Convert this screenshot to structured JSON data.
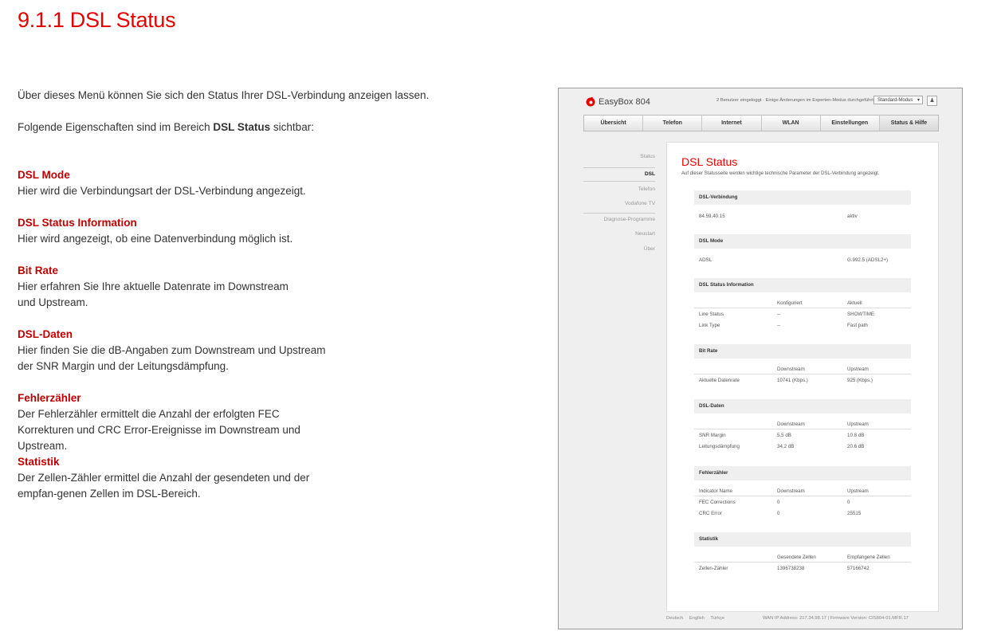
{
  "doc": {
    "title": "9.1.1 DSL Status",
    "intro1": "Über dieses Menü können Sie sich den Status Ihrer DSL-Verbindung anzeigen lassen.",
    "intro2_pre": "Folgende Eigenschaften sind im Bereich ",
    "intro2_bold": "DSL Status",
    "intro2_post": " sichtbar:",
    "properties": [
      {
        "heading": "DSL Mode",
        "text": "Hier wird die Verbindungsart der DSL-Verbindung angezeigt."
      },
      {
        "heading": "DSL Status Information",
        "text": "Hier wird angezeigt, ob eine Datenverbindung möglich ist."
      },
      {
        "heading": "Bit Rate",
        "text": "Hier erfahren Sie Ihre aktuelle Datenrate im Downstream und Upstream."
      },
      {
        "heading": "DSL-Daten",
        "text": "Hier finden Sie die dB-Angaben zum Downstream und Upstream der SNR Margin und der Leitungsdämpfung."
      },
      {
        "heading": "Fehlerzähler",
        "text": "Der Fehlerzähler ermittelt die Anzahl der erfolgten FEC Korrekturen und CRC Error-Ereignisse im Downstream und Upstream."
      },
      {
        "heading": "Statistik",
        "text": "Der Zellen-Zähler ermittel die Anzahl der gesendeten und der empfan-genen Zellen im DSL-Bereich."
      }
    ]
  },
  "screenshot": {
    "brand": "EasyBox 804",
    "brand_color": "#e60000",
    "logo_icon": "vodafone-logo-icon",
    "user_msg": "2 Benutzer eingeloggt · Einige Änderungen im Experten-Modus durchgeführt",
    "mode": "Standard-Modus",
    "nav": [
      "Übersicht",
      "Telefon",
      "Internet",
      "WLAN",
      "Einstellungen",
      "Status & Hilfe"
    ],
    "sidebar": [
      "Status",
      "DSL",
      "Telefon",
      "Vodafone TV",
      "Diagnose-Programme",
      "Neustart",
      "Über"
    ],
    "content_title": "DSL Status",
    "content_desc": "Auf dieser Statusseite werden wichtige technische Parameter der DSL-Verbindung angezeigt.",
    "sections": {
      "verbindung": {
        "title": "DSL-Verbindung",
        "ip": "84.59.40.15",
        "state": "aktiv"
      },
      "mode": {
        "title": "DSL Mode",
        "label": "ADSL",
        "value": "G.992.5 (ADSL2+)"
      },
      "info": {
        "title": "DSL Status Information",
        "h1": "Konfiguriert",
        "h2": "Aktuell",
        "rows": [
          [
            "Line Status",
            "--",
            "SHOWTIME"
          ],
          [
            "Link Type",
            "--",
            "Fast path"
          ]
        ]
      },
      "bitrate": {
        "title": "Bit Rate",
        "h1": "Downstream",
        "h2": "Upstream",
        "rows": [
          [
            "Aktuelle Datenrate",
            "10741 (Kbps.)",
            "925 (Kbps.)"
          ]
        ]
      },
      "daten": {
        "title": "DSL-Daten",
        "h1": "Downstream",
        "h2": "Upstream",
        "rows": [
          [
            "SNR Margin",
            "5.5 dB",
            "10.8 dB"
          ],
          [
            "Leitungsdämpfung",
            "34.2 dB",
            "20.6 dB"
          ]
        ]
      },
      "fehler": {
        "title": "Fehlerzähler",
        "h0": "Indicator Name",
        "h1": "Downstream",
        "h2": "Upstream",
        "rows": [
          [
            "FEC Corrections",
            "0",
            "0"
          ],
          [
            "CRC Error",
            "0",
            "25515"
          ]
        ]
      },
      "statistik": {
        "title": "Statistik",
        "h1": "Gesendete Zellen",
        "h2": "Empfangene Zellen",
        "rows": [
          [
            "Zellen-Zähler",
            "1396738238",
            "57166742"
          ]
        ]
      }
    },
    "footer_langs": [
      "Deutsch",
      "English",
      "Türkçe"
    ],
    "footer_info": "WAN IP Address: 217.34.98.17 | Firmware Version: CIS804-01.MFR.17"
  }
}
